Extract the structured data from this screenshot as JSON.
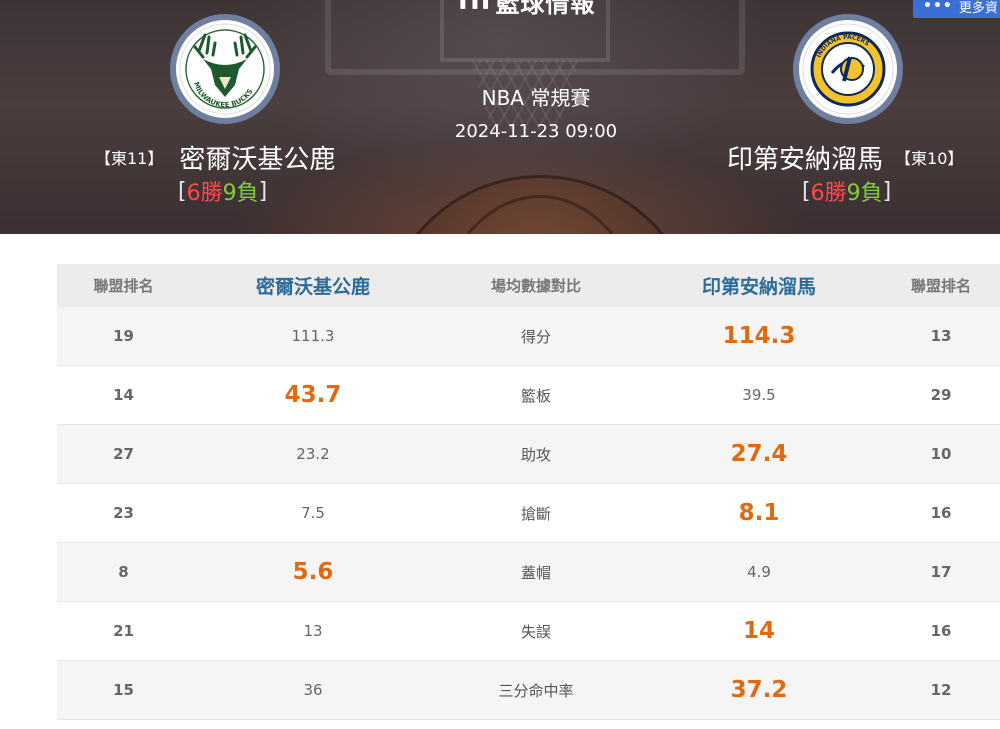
{
  "header": {
    "site_title": "籃球情報",
    "more_label": "更多資",
    "league": "NBA 常規賽",
    "datetime": "2024-11-23 09:00"
  },
  "teams": {
    "home": {
      "name": "密爾沃基公鹿",
      "conf_rank": "【東11】",
      "record_wins": "6勝",
      "record_losses": "9負",
      "logo_text": "MILWAUKEE BUCKS"
    },
    "away": {
      "name": "印第安納溜馬",
      "conf_rank": "【東10】",
      "record_wins": "6勝",
      "record_losses": "9負",
      "logo_text": "INDIANA PACERS"
    }
  },
  "table": {
    "headers": [
      "聯盟排名",
      "密爾沃基公鹿",
      "場均數據對比",
      "印第安納溜馬",
      "聯盟排名"
    ],
    "rows": [
      {
        "home_rank": "19",
        "home_value": "111.3",
        "label": "得分",
        "away_value": "114.3",
        "away_rank": "13",
        "leader": "away"
      },
      {
        "home_rank": "14",
        "home_value": "43.7",
        "label": "籃板",
        "away_value": "39.5",
        "away_rank": "29",
        "leader": "home"
      },
      {
        "home_rank": "27",
        "home_value": "23.2",
        "label": "助攻",
        "away_value": "27.4",
        "away_rank": "10",
        "leader": "away"
      },
      {
        "home_rank": "23",
        "home_value": "7.5",
        "label": "搶斷",
        "away_value": "8.1",
        "away_rank": "16",
        "leader": "away"
      },
      {
        "home_rank": "8",
        "home_value": "5.6",
        "label": "蓋帽",
        "away_value": "4.9",
        "away_rank": "17",
        "leader": "home"
      },
      {
        "home_rank": "21",
        "home_value": "13",
        "label": "失誤",
        "away_value": "14",
        "away_rank": "16",
        "leader": "away"
      },
      {
        "home_rank": "15",
        "home_value": "36",
        "label": "三分命中率",
        "away_value": "37.2",
        "away_rank": "12",
        "leader": "away"
      }
    ]
  },
  "colors": {
    "win": "#ff4a4a",
    "loss": "#7fcf3a",
    "highlight": "#e06a12",
    "team_header": "#2d6b99",
    "more_button": "#3b6fd6"
  }
}
